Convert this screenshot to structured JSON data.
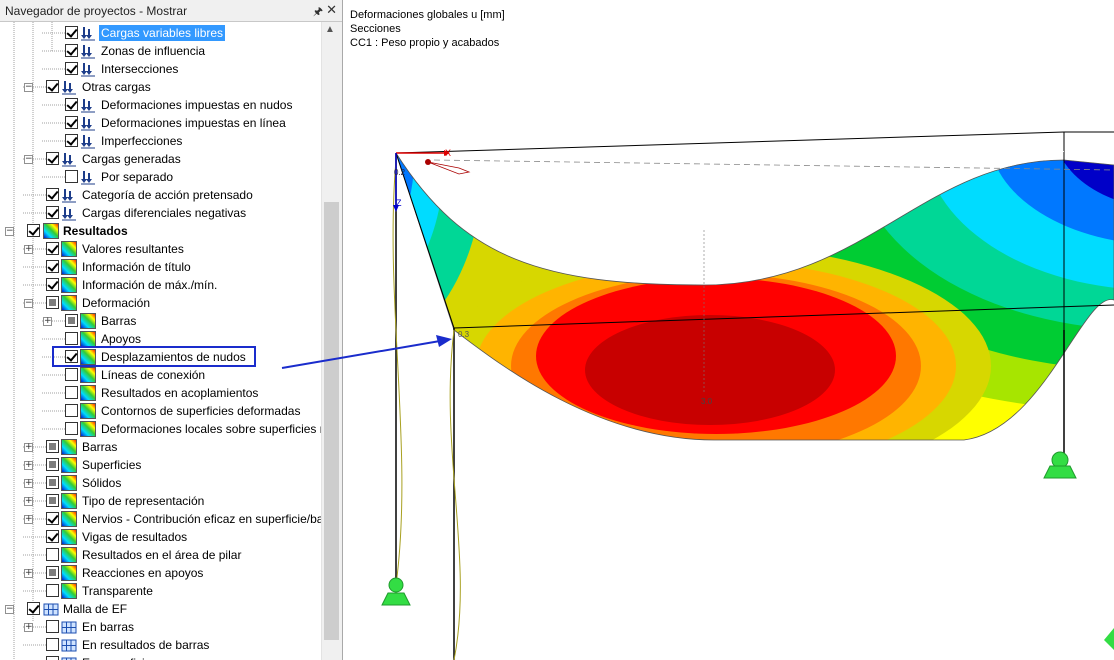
{
  "navigator": {
    "title": "Navegador de proyectos - Mostrar",
    "pin_icon": "pin-icon",
    "close_icon": "close-icon",
    "items": [
      {
        "label": "Cargas variables libres",
        "level": 3,
        "checked": true,
        "icon": "load-arrow-icon",
        "expander": false,
        "selected": true
      },
      {
        "label": "Zonas de influencia",
        "level": 3,
        "checked": true,
        "icon": "load-arrow-icon",
        "expander": false
      },
      {
        "label": "Intersecciones",
        "level": 3,
        "checked": true,
        "icon": "load-arrow-icon",
        "expander": false
      },
      {
        "label": "Otras cargas",
        "level": 2,
        "checked": true,
        "icon": "load-arrow-icon",
        "expander": "minus"
      },
      {
        "label": "Deformaciones impuestas en nudos",
        "level": 3,
        "checked": true,
        "icon": "load-arrow-icon",
        "expander": false
      },
      {
        "label": "Deformaciones impuestas en línea",
        "level": 3,
        "checked": true,
        "icon": "load-arrow-icon",
        "expander": false
      },
      {
        "label": "Imperfecciones",
        "level": 3,
        "checked": true,
        "icon": "load-arrow-icon",
        "expander": false
      },
      {
        "label": "Cargas generadas",
        "level": 2,
        "checked": true,
        "icon": "load-arrow-icon",
        "expander": "minus"
      },
      {
        "label": "Por separado",
        "level": 3,
        "checked": false,
        "icon": "load-arrow-icon",
        "expander": false
      },
      {
        "label": "Categoría de acción pretensado",
        "level": 2,
        "checked": true,
        "icon": "load-arrow-icon",
        "expander": false
      },
      {
        "label": "Cargas diferenciales negativas",
        "level": 2,
        "checked": true,
        "icon": "load-arrow-icon",
        "expander": false
      },
      {
        "label": "Resultados",
        "level": 1,
        "checked": true,
        "icon": "results-icon",
        "expander": "minus",
        "bold": true
      },
      {
        "label": "Valores resultantes",
        "level": 2,
        "checked": true,
        "icon": "results-icon",
        "expander": "plus"
      },
      {
        "label": "Información de título",
        "level": 2,
        "checked": true,
        "icon": "results-icon",
        "expander": false
      },
      {
        "label": "Información de máx./mín.",
        "level": 2,
        "checked": true,
        "icon": "results-icon",
        "expander": false
      },
      {
        "label": "Deformación",
        "level": 2,
        "checked": "partial",
        "icon": "results-icon",
        "expander": "minus"
      },
      {
        "label": "Barras",
        "level": 3,
        "checked": "partial",
        "icon": "results-icon",
        "expander": "plus"
      },
      {
        "label": "Apoyos",
        "level": 3,
        "checked": false,
        "icon": "results-icon",
        "expander": false
      },
      {
        "label": "Desplazamientos de nudos",
        "level": 3,
        "checked": true,
        "icon": "results-icon",
        "expander": false,
        "highlighted": true
      },
      {
        "label": "Líneas de conexión",
        "level": 3,
        "checked": false,
        "icon": "results-icon",
        "expander": false
      },
      {
        "label": "Resultados en acoplamientos",
        "level": 3,
        "checked": false,
        "icon": "results-icon",
        "expander": false
      },
      {
        "label": "Contornos de superficies deformadas",
        "level": 3,
        "checked": false,
        "icon": "results-icon",
        "expander": false
      },
      {
        "label": "Deformaciones locales sobre superficies n",
        "level": 3,
        "checked": false,
        "icon": "results-icon",
        "expander": false
      },
      {
        "label": "Barras",
        "level": 2,
        "checked": "partial",
        "icon": "results-icon",
        "expander": "plus"
      },
      {
        "label": "Superficies",
        "level": 2,
        "checked": "partial",
        "icon": "results-icon",
        "expander": "plus"
      },
      {
        "label": "Sólidos",
        "level": 2,
        "checked": "partial",
        "icon": "results-icon",
        "expander": "plus"
      },
      {
        "label": "Tipo de representación",
        "level": 2,
        "checked": "partial",
        "icon": "results-icon",
        "expander": "plus"
      },
      {
        "label": "Nervios - Contribución eficaz en superficie/ba",
        "level": 2,
        "checked": true,
        "icon": "results-icon",
        "expander": "plus"
      },
      {
        "label": "Vigas de resultados",
        "level": 2,
        "checked": true,
        "icon": "results-icon",
        "expander": false
      },
      {
        "label": "Resultados en el área de pilar",
        "level": 2,
        "checked": false,
        "icon": "results-icon",
        "expander": false
      },
      {
        "label": "Reacciones en apoyos",
        "level": 2,
        "checked": "partial",
        "icon": "results-icon",
        "expander": "plus"
      },
      {
        "label": "Transparente",
        "level": 2,
        "checked": false,
        "icon": "results-icon",
        "expander": false
      },
      {
        "label": "Malla de EF",
        "level": 1,
        "checked": true,
        "icon": "mesh-icon",
        "expander": "minus"
      },
      {
        "label": "En barras",
        "level": 2,
        "checked": false,
        "icon": "mesh-icon",
        "expander": "plus"
      },
      {
        "label": "En resultados de barras",
        "level": 2,
        "checked": false,
        "icon": "mesh-icon",
        "expander": false
      },
      {
        "label": "En superficies",
        "level": 2,
        "checked": false,
        "icon": "mesh-icon",
        "expander": false
      }
    ]
  },
  "viewport": {
    "info_lines": [
      "Deformaciones globales u [mm]",
      "Secciones",
      "CC1 : Peso propio y acabados"
    ],
    "axis_x": "X",
    "axis_z": "Z",
    "labels": {
      "top_right": "0.1",
      "corner_left": "0.3",
      "center": "3.0",
      "corner_axis": "0.2"
    },
    "contour_colors": [
      "#0000c8",
      "#0078ff",
      "#00dcff",
      "#00d796",
      "#00cc33",
      "#a7e500",
      "#ffff00",
      "#d7d700",
      "#ffb400",
      "#ff7800",
      "#ff0000",
      "#c80000"
    ],
    "support_color": "#33dd44"
  }
}
